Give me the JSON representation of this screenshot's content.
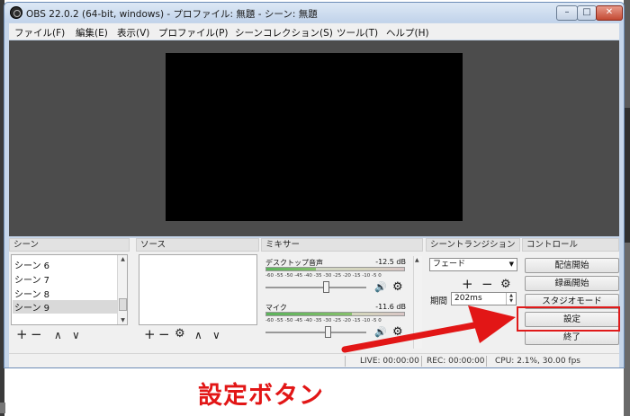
{
  "window": {
    "title": "OBS 22.0.2 (64-bit, windows) - プロファイル: 無題 - シーン: 無題",
    "controls": {
      "minimize": "–",
      "maximize": "□",
      "close": "✕"
    }
  },
  "menu": [
    "ファイル(F)",
    "編集(E)",
    "表示(V)",
    "プロファイル(P)",
    "シーンコレクション(S)",
    "ツール(T)",
    "ヘルプ(H)"
  ],
  "panels": {
    "scenes": {
      "header": "シーン",
      "items": [
        "シーン 6",
        "シーン 7",
        "シーン 8",
        "シーン 9"
      ],
      "selected_index": 3,
      "tools": {
        "add": "+",
        "remove": "−",
        "up": "∧",
        "down": "∨"
      }
    },
    "sources": {
      "header": "ソース",
      "tools": {
        "add": "+",
        "remove": "−",
        "settings": "⚙",
        "up": "∧",
        "down": "∨"
      }
    },
    "mixer": {
      "header": "ミキサー",
      "ticks": "-60  -55  -50  -45  -40  -35  -30  -25  -20  -15  -10   -5   0",
      "channels": [
        {
          "name": "デスクトップ音声",
          "db": "-12.5 dB",
          "level": 0.36,
          "volume": 0.6
        },
        {
          "name": "マイク",
          "db": "-11.6 dB",
          "level": 0.62,
          "volume": 0.62
        }
      ],
      "speaker_icon": "🔊",
      "gear_icon": "⚙"
    },
    "transitions": {
      "header": "シーントランジション",
      "selected": "フェード",
      "add": "+",
      "remove": "−",
      "settings": "⚙",
      "duration_label": "期間",
      "duration_value": "202ms"
    },
    "controls": {
      "header": "コントロール",
      "buttons": [
        "配信開始",
        "録画開始",
        "スタジオモード",
        "設定",
        "終了"
      ]
    }
  },
  "status": {
    "live": "LIVE: 00:00:00",
    "rec": "REC: 00:00:00",
    "cpu": "CPU: 2.1%, 30.00 fps"
  },
  "annotation": {
    "caption": "設定ボタン",
    "color": "#e21616"
  }
}
